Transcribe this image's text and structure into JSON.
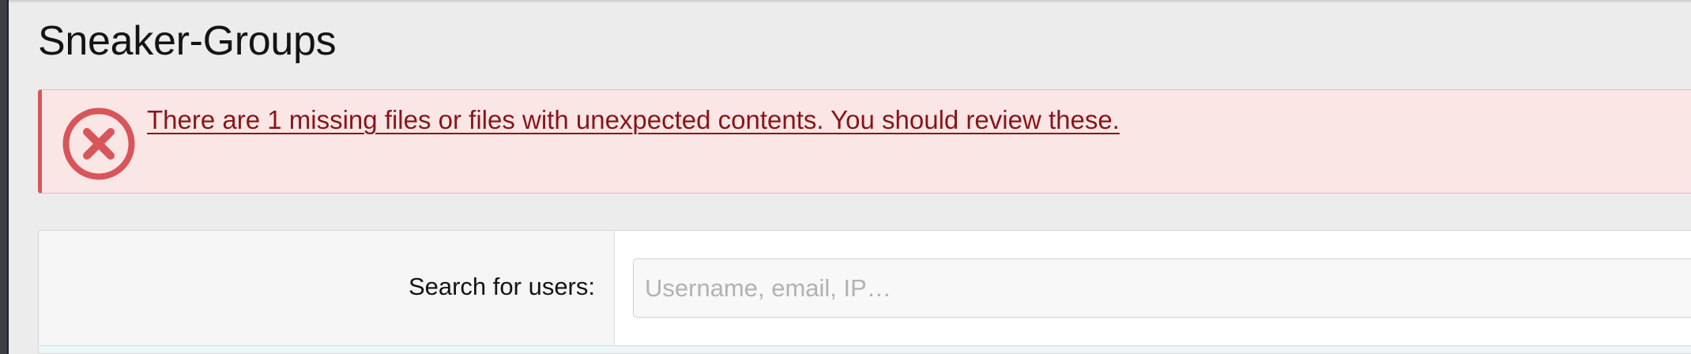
{
  "header": {
    "title": "Sneaker-Groups"
  },
  "alert": {
    "icon": "error-circle-x-icon",
    "message": "There are 1 missing files or files with unexpected contents. You should review these.",
    "accent_color": "#d8555a",
    "background_color": "#fbe6e6",
    "text_color": "#8a1418"
  },
  "search": {
    "label": "Search for users:",
    "placeholder": "Username, email, IP…",
    "value": ""
  }
}
